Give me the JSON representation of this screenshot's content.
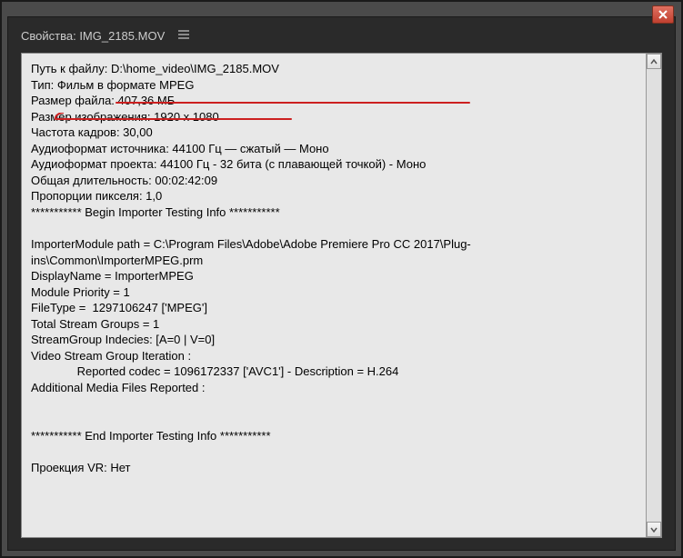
{
  "window": {
    "title_prefix": "Свойства: ",
    "filename": "IMG_2185.MOV"
  },
  "lines": {
    "l1": "Путь к файлу: D:\\home_video\\IMG_2185.MOV",
    "l2": "Тип: Фильм в формате MPEG",
    "l3": "Размер файла: 407,36 МБ",
    "l4": "Размер изображения: 1920 x 1080",
    "l5": "Частота кадров: 30,00",
    "l6": "Аудиоформат источника: 44100 Гц — сжатый — Моно",
    "l7": "Аудиоформат проекта: 44100 Гц - 32 бита (с плавающей точкой) - Моно",
    "l8": "Общая длительность: 00:02:42:09",
    "l9": "Пропорции пикселя: 1,0",
    "l10": "*********** Begin Importer Testing Info ***********",
    "l11": "",
    "l12": "ImporterModule path = C:\\Program Files\\Adobe\\Adobe Premiere Pro CC 2017\\Plug-ins\\Common\\ImporterMPEG.prm",
    "l13": "DisplayName = ImporterMPEG",
    "l14": "Module Priority = 1",
    "l15": "FileType =  1297106247 ['MPEG']",
    "l16": "Total Stream Groups = 1",
    "l17": "StreamGroup Indecies: [A=0 | V=0]",
    "l18": "Video Stream Group Iteration :",
    "l19": "              Reported codec = 1096172337 ['AVC1'] - Description = H.264",
    "l20": "Additional Media Files Reported :",
    "l21": "",
    "l22": "",
    "l23": "*********** End Importer Testing Info ***********",
    "l24": "",
    "l25": "Проекция VR: Нет"
  }
}
